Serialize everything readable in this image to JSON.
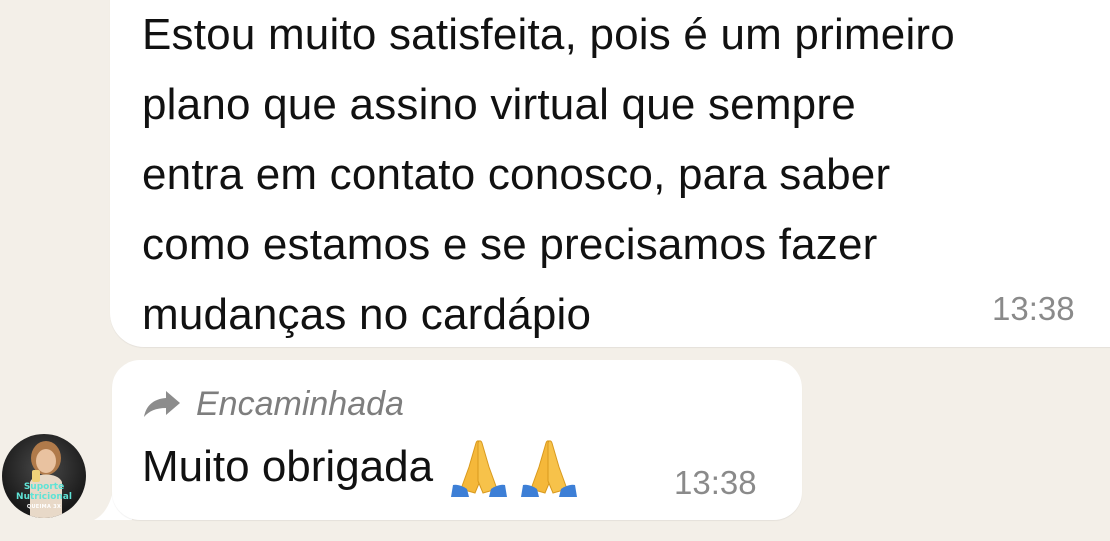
{
  "chat": {
    "messages": [
      {
        "lines": [
          "Estou muito satisfeita, pois é um primeiro",
          "plano que assino virtual que sempre",
          "entra em contato conosco, para saber",
          "como estamos e se precisamos fazer",
          "mudanças no cardápio"
        ],
        "time": "13:38"
      },
      {
        "forwarded_label": "Encaminhada",
        "text": "Muito obrigada",
        "emojis": [
          "folded-hands",
          "folded-hands"
        ],
        "time": "13:38"
      }
    ],
    "avatar": {
      "label_line1": "Suporte",
      "label_line2": "Nutricional",
      "brand": "QUEIMA 3X"
    }
  },
  "colors": {
    "background": "#f3efe8",
    "bubble": "#ffffff",
    "text": "#111111",
    "meta": "#8a8a8a",
    "avatar_label": "#5fe3d6"
  }
}
